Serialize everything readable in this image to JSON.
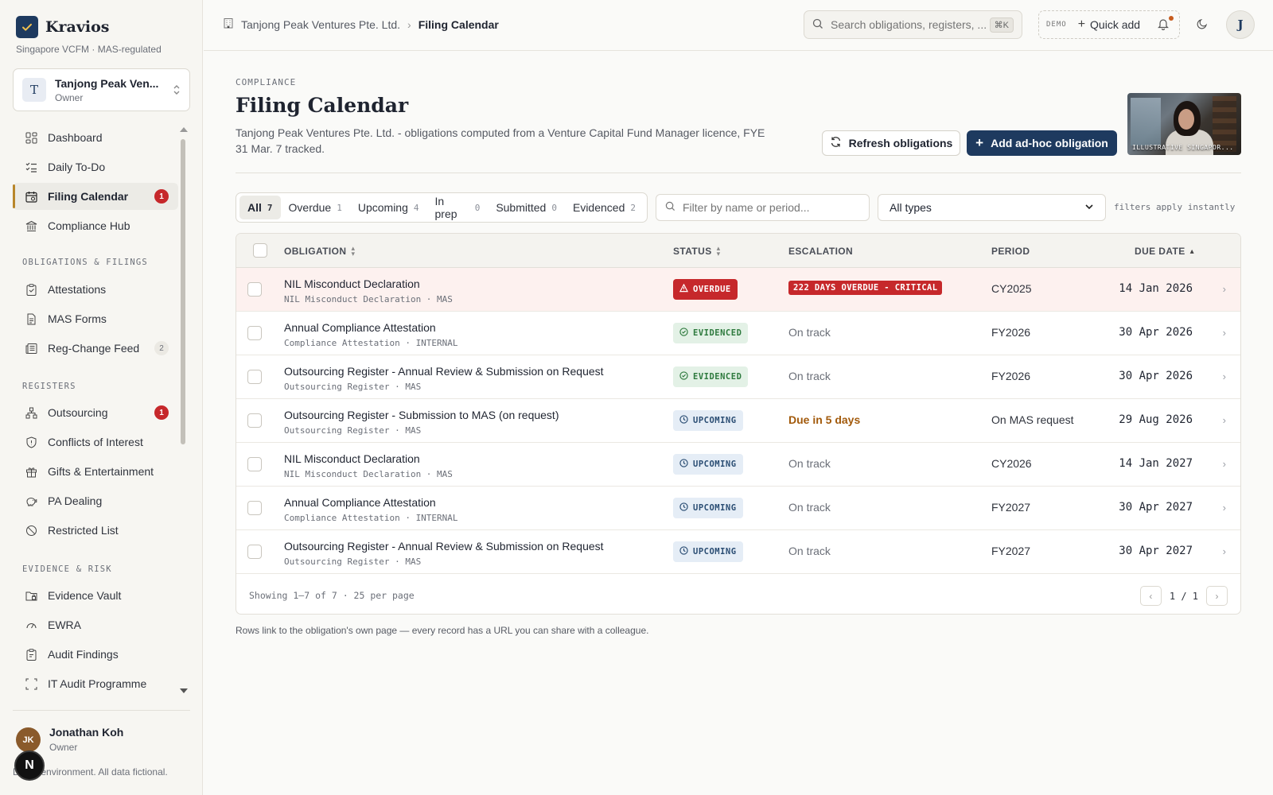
{
  "brand": {
    "name": "Kravios",
    "subtitle": "Singapore VCFM · MAS-regulated"
  },
  "org": {
    "initial": "T",
    "name": "Tanjong Peak Ven...",
    "role": "Owner"
  },
  "nav": {
    "top": [
      {
        "label": "Dashboard",
        "icon": "dashboard-icon"
      },
      {
        "label": "Daily To-Do",
        "icon": "checklist-icon"
      },
      {
        "label": "Filing Calendar",
        "icon": "calendar-icon",
        "badge": "1",
        "active": true
      },
      {
        "label": "Compliance Hub",
        "icon": "bank-icon"
      }
    ],
    "sections": [
      {
        "title": "OBLIGATIONS & FILINGS",
        "items": [
          {
            "label": "Attestations",
            "icon": "clipboard-icon"
          },
          {
            "label": "MAS Forms",
            "icon": "document-icon"
          },
          {
            "label": "Reg-Change Feed",
            "icon": "newspaper-icon",
            "count": "2"
          }
        ]
      },
      {
        "title": "REGISTERS",
        "items": [
          {
            "label": "Outsourcing",
            "icon": "network-icon",
            "badge": "1"
          },
          {
            "label": "Conflicts of Interest",
            "icon": "shield-icon"
          },
          {
            "label": "Gifts & Entertainment",
            "icon": "gift-icon"
          },
          {
            "label": "PA Dealing",
            "icon": "piggy-bank-icon"
          },
          {
            "label": "Restricted List",
            "icon": "ban-icon"
          }
        ]
      },
      {
        "title": "EVIDENCE & RISK",
        "items": [
          {
            "label": "Evidence Vault",
            "icon": "folder-lock-icon"
          },
          {
            "label": "EWRA",
            "icon": "gauge-icon"
          },
          {
            "label": "Audit Findings",
            "icon": "clipboard-check-icon"
          },
          {
            "label": "IT Audit Programme",
            "icon": "scan-icon"
          }
        ]
      }
    ]
  },
  "user": {
    "initials": "JK",
    "name": "Jonathan Koh",
    "role": "Owner",
    "note": "Demo environment. All data fictional.",
    "n_button": "N"
  },
  "topbar": {
    "breadcrumb_org": "Tanjong Peak Ventures Pte. Ltd.",
    "breadcrumb_current": "Filing Calendar",
    "search_placeholder": "Search obligations, registers, ...",
    "search_shortcut": "⌘K",
    "demo_tag": "DEMO",
    "quick_add": "Quick add",
    "avatar_initial": "J"
  },
  "page": {
    "eyebrow": "COMPLIANCE",
    "title": "Filing Calendar",
    "description": "Tanjong Peak Ventures Pte. Ltd. - obligations computed from a Venture Capital Fund Manager licence, FYE 31 Mar. 7 tracked.",
    "refresh_label": "Refresh obligations",
    "add_label": "Add ad-hoc obligation",
    "photo_caption": "ILLUSTRATIVE SINGAPOR..."
  },
  "filters": {
    "tabs": [
      {
        "label": "All",
        "count": "7",
        "active": true
      },
      {
        "label": "Overdue",
        "count": "1"
      },
      {
        "label": "Upcoming",
        "count": "4"
      },
      {
        "label": "In prep",
        "count": "0"
      },
      {
        "label": "Submitted",
        "count": "0"
      },
      {
        "label": "Evidenced",
        "count": "2"
      }
    ],
    "search_placeholder": "Filter by name or period...",
    "type_selected": "All types",
    "hint": "filters apply instantly"
  },
  "table": {
    "columns": {
      "obligation": "OBLIGATION",
      "status": "STATUS",
      "escalation": "ESCALATION",
      "period": "PERIOD",
      "due_date": "DUE DATE"
    },
    "rows": [
      {
        "title": "NIL Misconduct Declaration",
        "sub": "NIL Misconduct Declaration · MAS",
        "status": "OVERDUE",
        "status_kind": "overdue",
        "escalation": "222 DAYS OVERDUE - CRITICAL",
        "escalation_kind": "critical",
        "period": "CY2025",
        "due": "14 Jan 2026"
      },
      {
        "title": "Annual Compliance Attestation",
        "sub": "Compliance Attestation · INTERNAL",
        "status": "EVIDENCED",
        "status_kind": "evidenced",
        "escalation": "On track",
        "escalation_kind": "ok",
        "period": "FY2026",
        "due": "30 Apr 2026"
      },
      {
        "title": "Outsourcing Register - Annual Review & Submission on Request",
        "sub": "Outsourcing Register · MAS",
        "status": "EVIDENCED",
        "status_kind": "evidenced",
        "escalation": "On track",
        "escalation_kind": "ok",
        "period": "FY2026",
        "due": "30 Apr 2026"
      },
      {
        "title": "Outsourcing Register - Submission to MAS (on request)",
        "sub": "Outsourcing Register · MAS",
        "status": "UPCOMING",
        "status_kind": "upcoming",
        "escalation": "Due in 5 days",
        "escalation_kind": "soon",
        "period": "On MAS request",
        "due": "29 Aug 2026"
      },
      {
        "title": "NIL Misconduct Declaration",
        "sub": "NIL Misconduct Declaration · MAS",
        "status": "UPCOMING",
        "status_kind": "upcoming",
        "escalation": "On track",
        "escalation_kind": "ok",
        "period": "CY2026",
        "due": "14 Jan 2027"
      },
      {
        "title": "Annual Compliance Attestation",
        "sub": "Compliance Attestation · INTERNAL",
        "status": "UPCOMING",
        "status_kind": "upcoming",
        "escalation": "On track",
        "escalation_kind": "ok",
        "period": "FY2027",
        "due": "30 Apr 2027"
      },
      {
        "title": "Outsourcing Register - Annual Review & Submission on Request",
        "sub": "Outsourcing Register · MAS",
        "status": "UPCOMING",
        "status_kind": "upcoming",
        "escalation": "On track",
        "escalation_kind": "ok",
        "period": "FY2027",
        "due": "30 Apr 2027"
      }
    ],
    "showing": "Showing 1–7 of 7 · 25 per page",
    "page_label": "1 / 1"
  },
  "footnote": "Rows link to the obligation's own page — every record has a URL you can share with a colleague.",
  "colors": {
    "primary": "#1e3a5f",
    "accent": "#b8862a",
    "danger": "#c6282b",
    "success": "#2e7a3e"
  }
}
